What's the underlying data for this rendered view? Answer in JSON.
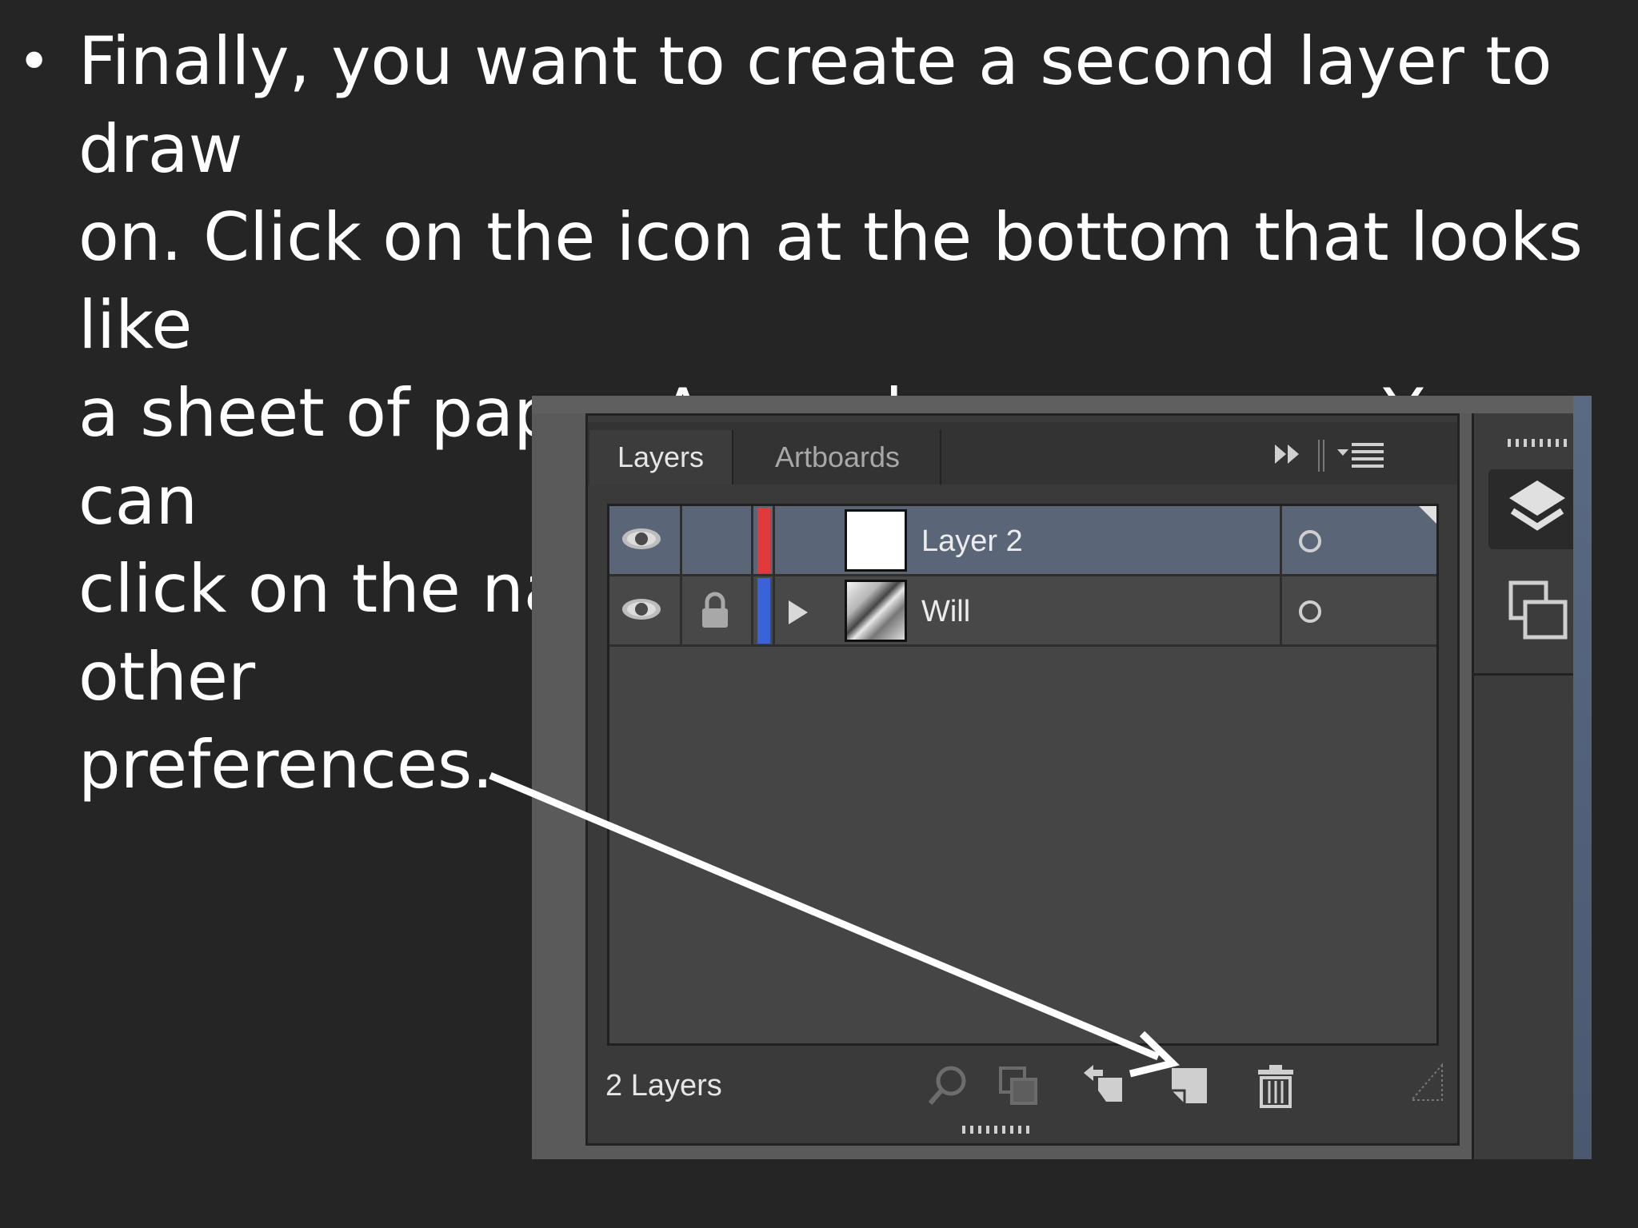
{
  "slide": {
    "bullet": "•",
    "lines": [
      "Finally, you want to create a second layer to draw",
      "on. Click on the icon at the bottom that looks like",
      "a sheet of paper. A new layer appears. You can",
      "click on the name to change the name or other",
      "preferences."
    ]
  },
  "panel": {
    "tabs": [
      {
        "label": "Layers",
        "active": true
      },
      {
        "label": "Artboards",
        "active": false
      }
    ],
    "collapse_icon": "double-chevron-right-icon",
    "menu_icon": "panel-menu-icon",
    "layers": [
      {
        "name": "Layer 2",
        "visible": true,
        "locked": false,
        "color": "#e23a3a",
        "selected": true,
        "expandable": false
      },
      {
        "name": "Will",
        "visible": true,
        "locked": true,
        "color": "#3a63d9",
        "selected": false,
        "expandable": true
      }
    ],
    "status": "2 Layers",
    "bottom_icons": [
      "locate-object-icon",
      "make-clipping-mask-icon",
      "create-sublayer-icon",
      "new-layer-icon",
      "delete-layer-icon"
    ]
  },
  "dock": {
    "icons": [
      "layers-panel-icon",
      "artboards-panel-icon"
    ]
  },
  "colors": {
    "background": "#252525",
    "selected_row": "#5a6677",
    "annotation_arrow": "#ffffff"
  }
}
